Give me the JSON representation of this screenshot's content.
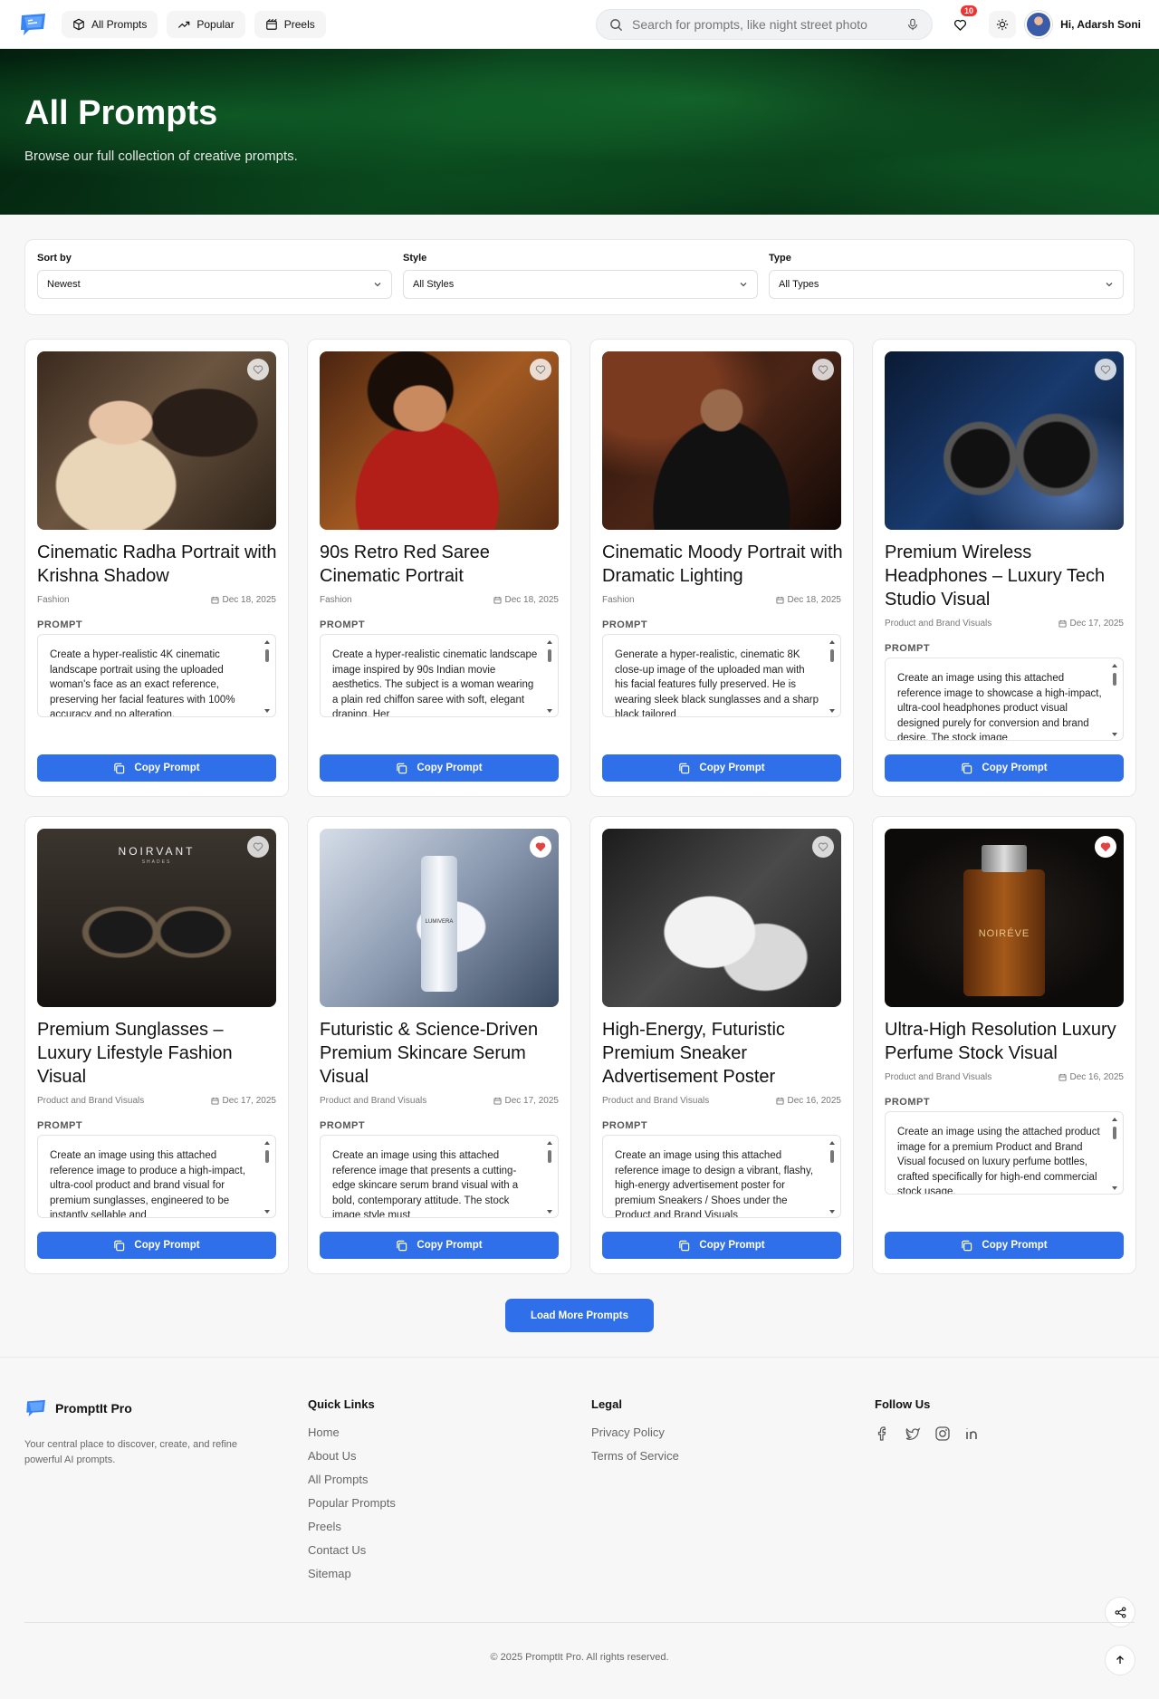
{
  "nav": {
    "items": [
      "All Prompts",
      "Popular",
      "Preels"
    ],
    "search_placeholder": "Search for prompts, like night street photo",
    "wishlist_count": "10",
    "user_greeting": "Hi, Adarsh Soni"
  },
  "hero": {
    "title": "All Prompts",
    "subtitle": "Browse our full collection of creative prompts."
  },
  "filters": {
    "sort": {
      "label": "Sort by",
      "value": "Newest"
    },
    "style": {
      "label": "Style",
      "value": "All Styles"
    },
    "type": {
      "label": "Type",
      "value": "All Types"
    }
  },
  "prompt_label": "PROMPT",
  "copy_label": "Copy Prompt",
  "cards": [
    {
      "title": "Cinematic Radha Portrait with Krishna Shadow",
      "category": "Fashion",
      "date": "Dec 18, 2025",
      "text": "Create a hyper-realistic 4K cinematic landscape portrait using the uploaded woman's face as an exact reference, preserving her facial features with 100% accuracy and no alteration.",
      "liked": false
    },
    {
      "title": "90s Retro Red Saree Cinematic Portrait",
      "category": "Fashion",
      "date": "Dec 18, 2025",
      "text": "Create a hyper-realistic cinematic landscape image inspired by 90s Indian movie aesthetics. The subject is a woman wearing a plain red chiffon saree with soft, elegant draping. Her",
      "liked": false
    },
    {
      "title": "Cinematic Moody Portrait with Dramatic Lighting",
      "category": "Fashion",
      "date": "Dec 18, 2025",
      "text": "Generate a hyper-realistic, cinematic 8K close-up image of the uploaded man with his facial features fully preserved. He is wearing sleek black sunglasses and a sharp black tailored",
      "liked": false
    },
    {
      "title": "Premium Wireless Headphones – Luxury Tech Studio Visual",
      "category": "Product and Brand Visuals",
      "date": "Dec 17, 2025",
      "text": "Create an image using this attached reference image to showcase a high-impact, ultra-cool headphones product visual designed purely for conversion and brand desire. The stock image",
      "liked": false
    },
    {
      "title": "Premium Sunglasses – Luxury Lifestyle Fashion Visual",
      "category": "Product and Brand Visuals",
      "date": "Dec 17, 2025",
      "text": "Create an image using this attached reference image to produce a high-impact, ultra-cool product and brand visual for premium sunglasses, engineered to be instantly sellable and",
      "liked": false
    },
    {
      "title": "Futuristic & Science-Driven Premium Skincare Serum Visual",
      "category": "Product and Brand Visuals",
      "date": "Dec 17, 2025",
      "text": "Create an image using this attached reference image that presents a cutting-edge skincare serum brand visual with a bold, contemporary attitude. The stock image style must",
      "liked": true
    },
    {
      "title": "High-Energy, Futuristic Premium Sneaker Advertisement Poster",
      "category": "Product and Brand Visuals",
      "date": "Dec 16, 2025",
      "text": "Create an image using this attached reference image to design a vibrant, flashy, high-energy advertisement poster for premium Sneakers / Shoes under the Product and Brand Visuals",
      "liked": false
    },
    {
      "title": "Ultra-High Resolution Luxury Perfume Stock Visual",
      "category": "Product and Brand Visuals",
      "date": "Dec 16, 2025",
      "text": "Create an image using the attached product image for a premium Product and Brand Visual focused on luxury perfume bottles, crafted specifically for high-end commercial stock usage.",
      "liked": true
    }
  ],
  "image_text": {
    "sunglasses_brand": "NOIRVANT",
    "sunglasses_sub": "SHADES",
    "serum_brand": "LUMIVERA",
    "perfume_brand": "NOIRÉVE"
  },
  "load_more": "Load More Prompts",
  "footer": {
    "brand": "PromptIt Pro",
    "tagline": "Your central place to discover, create, and refine powerful AI prompts.",
    "quick_links_title": "Quick Links",
    "quick_links": [
      "Home",
      "About Us",
      "All Prompts",
      "Popular Prompts",
      "Preels",
      "Contact Us",
      "Sitemap"
    ],
    "legal_title": "Legal",
    "legal_links": [
      "Privacy Policy",
      "Terms of Service"
    ],
    "follow_title": "Follow Us",
    "copyright": "© 2025 PromptIt Pro. All rights reserved."
  },
  "colors": {
    "accent": "#2f6fe9",
    "liked": "#e04444"
  }
}
